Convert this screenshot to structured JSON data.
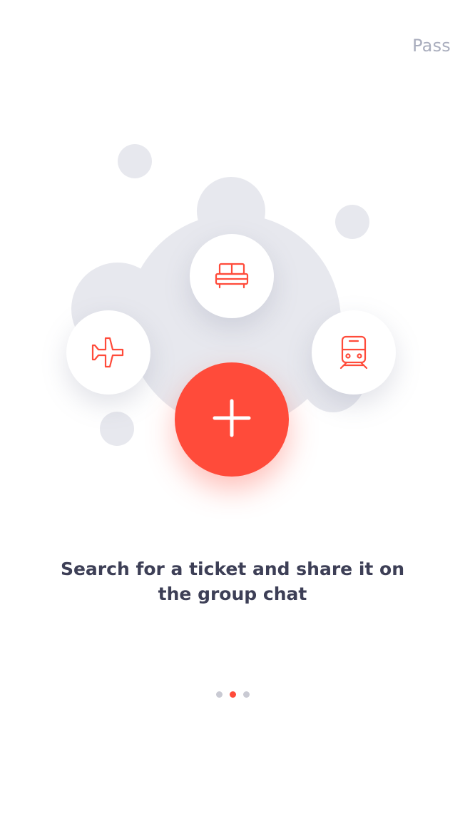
{
  "header": {
    "skip_label": "Pass"
  },
  "illustration": {
    "icons": [
      "bed-icon",
      "plane-icon",
      "train-icon",
      "plus-icon"
    ],
    "accent_color": "#ff4b3a",
    "blob_color": "#e7e8ee"
  },
  "onboarding": {
    "caption": "Search for a ticket and share it on the group chat"
  },
  "pagination": {
    "total": 3,
    "active_index": 1,
    "active_color": "#ff4b3a",
    "inactive_color": "#c9cad3"
  }
}
